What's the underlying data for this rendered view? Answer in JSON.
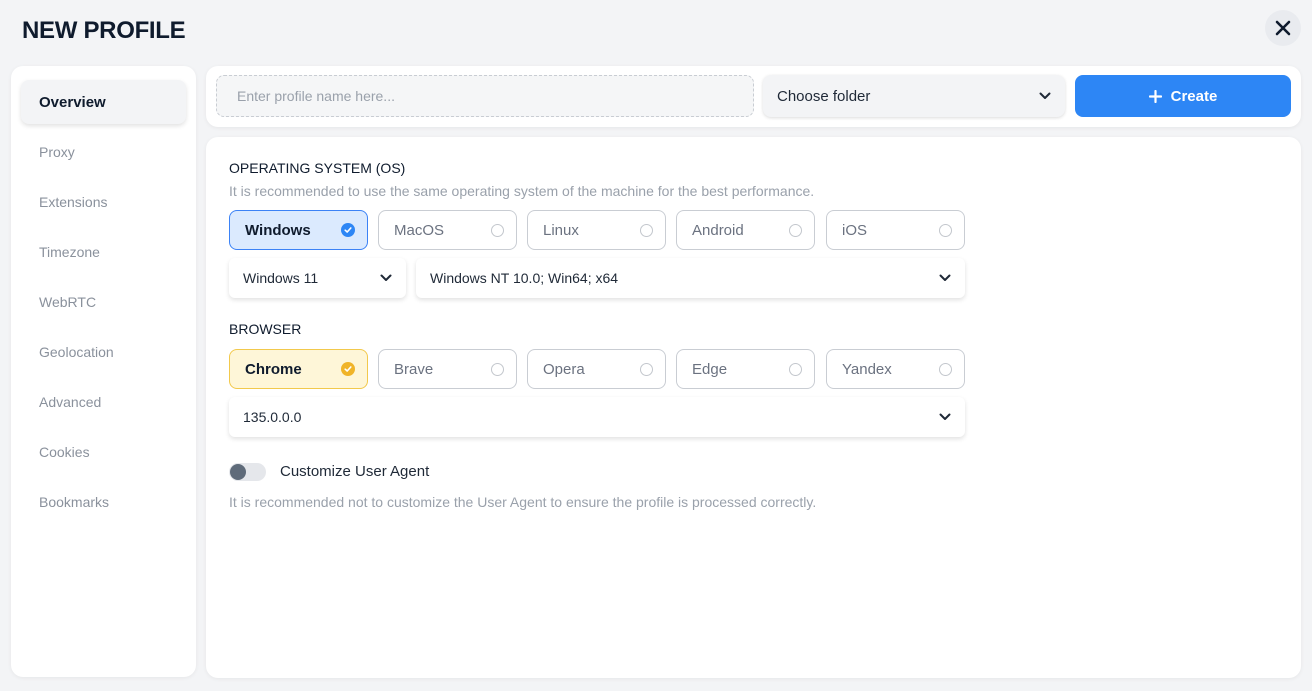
{
  "window": {
    "title": "NEW PROFILE",
    "close_icon": "close-icon"
  },
  "sidebar": {
    "items": [
      {
        "label": "Overview",
        "active": true
      },
      {
        "label": "Proxy",
        "active": false
      },
      {
        "label": "Extensions",
        "active": false
      },
      {
        "label": "Timezone",
        "active": false
      },
      {
        "label": "WebRTC",
        "active": false
      },
      {
        "label": "Geolocation",
        "active": false
      },
      {
        "label": "Advanced",
        "active": false
      },
      {
        "label": "Cookies",
        "active": false
      },
      {
        "label": "Bookmarks",
        "active": false
      }
    ]
  },
  "topbar": {
    "name_value": "",
    "name_placeholder": "Enter profile name here...",
    "folder_value": "Choose folder",
    "create_label": "Create"
  },
  "os": {
    "title": "OPERATING SYSTEM (OS)",
    "hint": "It is recommended to use the same operating system of the machine for the best performance.",
    "options": [
      "Windows",
      "MacOS",
      "Linux",
      "Android",
      "iOS"
    ],
    "selected": "Windows",
    "version_value": "Windows 11",
    "platform_value": "Windows NT 10.0; Win64; x64"
  },
  "browser": {
    "title": "BROWSER",
    "options": [
      "Chrome",
      "Brave",
      "Opera",
      "Edge",
      "Yandex"
    ],
    "selected": "Chrome",
    "version_value": "135.0.0.0"
  },
  "user_agent": {
    "toggle_label": "Customize User Agent",
    "enabled": false,
    "hint": "It is recommended not to customize the User Agent to ensure the profile is processed correctly."
  },
  "colors": {
    "accent": "#2d86f5",
    "os_selected_bg": "#dbeafe",
    "browser_selected_bg": "#fef6d8",
    "browser_selected_check": "#f0b429"
  }
}
